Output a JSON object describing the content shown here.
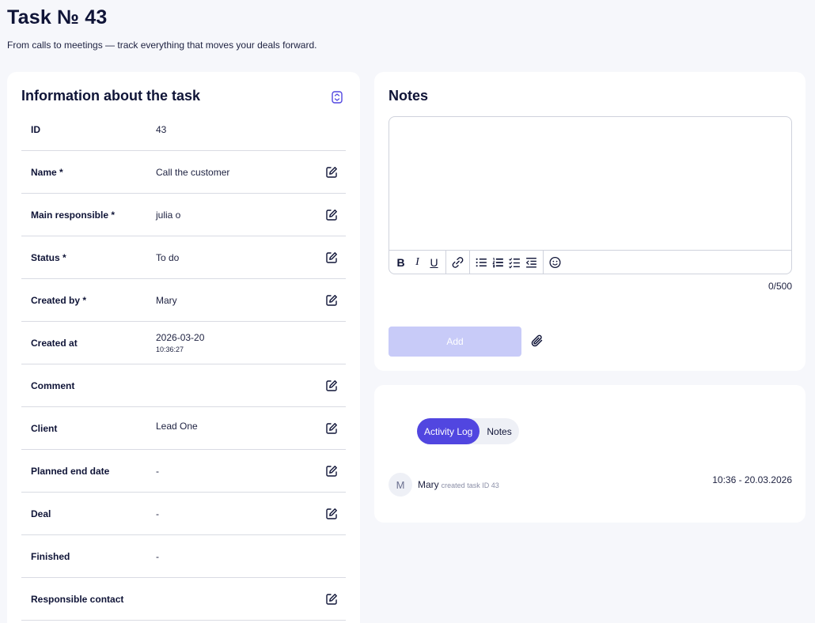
{
  "header": {
    "title": "Task № 43",
    "subtitle": "From calls to meetings — track everything that moves your deals forward."
  },
  "info": {
    "title": "Information about the task",
    "rows": [
      {
        "label": "ID",
        "value": "43"
      },
      {
        "label": "Name *",
        "value": "Call the customer"
      },
      {
        "label": "Main responsible *",
        "value": "julia o"
      },
      {
        "label": "Status *",
        "value": "To do"
      },
      {
        "label": "Created by *",
        "value": "Mary"
      },
      {
        "label": "Created at",
        "value": "2026-03-20",
        "sub": "10:36:27"
      },
      {
        "label": "Comment",
        "value": ""
      },
      {
        "label": "Client",
        "value": "Lead One"
      },
      {
        "label": "Planned end date",
        "value": "-"
      },
      {
        "label": "Deal",
        "value": "-"
      },
      {
        "label": "Finished",
        "value": "-"
      },
      {
        "label": "Responsible contact",
        "value": ""
      }
    ]
  },
  "notes": {
    "title": "Notes",
    "editor_value": "",
    "toolbar": {
      "bold": "B",
      "italic": "I",
      "underline": "U"
    },
    "char_count": "0/500",
    "add_label": "Add"
  },
  "activity": {
    "tabs": [
      {
        "label": "Activity Log",
        "active": true
      },
      {
        "label": "Notes",
        "active": false
      }
    ],
    "entries": [
      {
        "avatar": "M",
        "user": "Mary",
        "action": "created task ID 43",
        "time": "10:36 - 20.03.2026"
      }
    ]
  },
  "colors": {
    "accent": "#5146e0",
    "add_button_disabled": "#c8cbf8",
    "text_dark": "#0f1437",
    "background": "#f6f7fb"
  },
  "icons": {
    "collapse": "collapse-icon",
    "edit": "edit-icon",
    "link": "link-icon",
    "bullet_list": "bullet-list-icon",
    "numbered_list": "numbered-list-icon",
    "checklist": "checklist-icon",
    "indent": "indent-icon",
    "emoji": "emoji-icon",
    "attach": "paperclip-icon"
  }
}
